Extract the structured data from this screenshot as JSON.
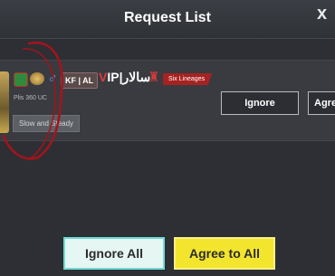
{
  "header": {
    "title": "Request List",
    "close_glyph": "x"
  },
  "request": {
    "tag": "KF | AL",
    "name_prefix": "V",
    "name_rest": "IP|ساﻻر",
    "lineage_badge": "Six Lineages",
    "status": "Plis 360 UC",
    "signature": "Slow and Steady",
    "ignore_label": "Ignore",
    "agree_label": "Agree"
  },
  "footer": {
    "ignore_all_label": "Ignore All",
    "agree_all_label": "Agree to All"
  },
  "colors": {
    "accent_yellow": "#f3e52e",
    "accent_cyan": "#6edcd5",
    "lineage_red": "#a72222",
    "scribble_red": "#a3141c"
  },
  "icons": [
    "close-icon",
    "flag-badge-icon",
    "rank-emblem-icon",
    "male-gender-icon",
    "lineage-icon"
  ]
}
